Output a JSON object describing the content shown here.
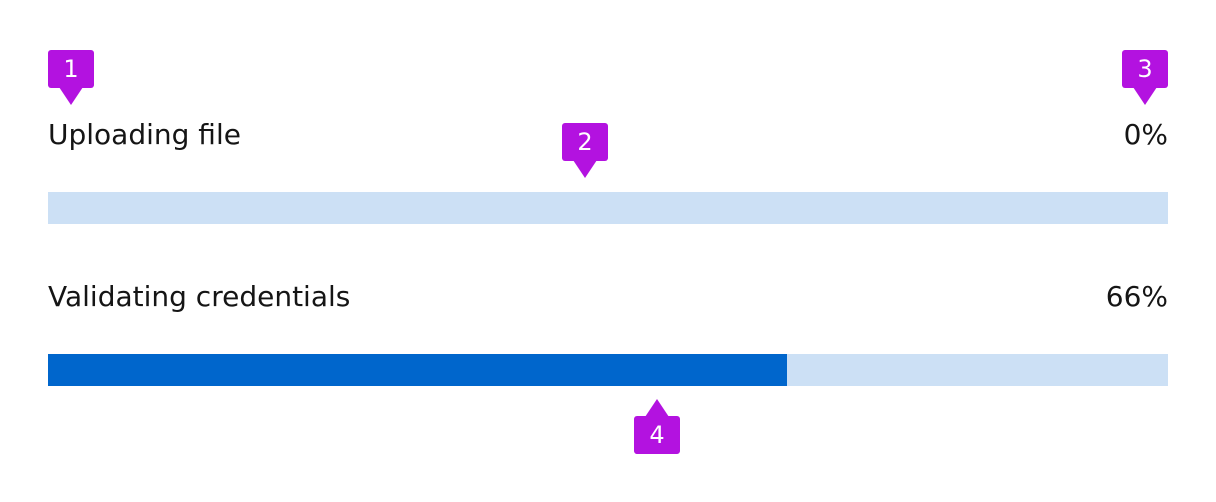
{
  "colors": {
    "track": "#cce0f5",
    "fill": "#0066cc",
    "callout": "#b312e0",
    "text": "#151515"
  },
  "progress_items": [
    {
      "title": "Uploading file",
      "value_label": "0%",
      "value": 0.0
    },
    {
      "title": "Validating credentials",
      "value_label": "66%",
      "value": 0.66
    }
  ],
  "callouts": [
    "1",
    "2",
    "3",
    "4"
  ]
}
